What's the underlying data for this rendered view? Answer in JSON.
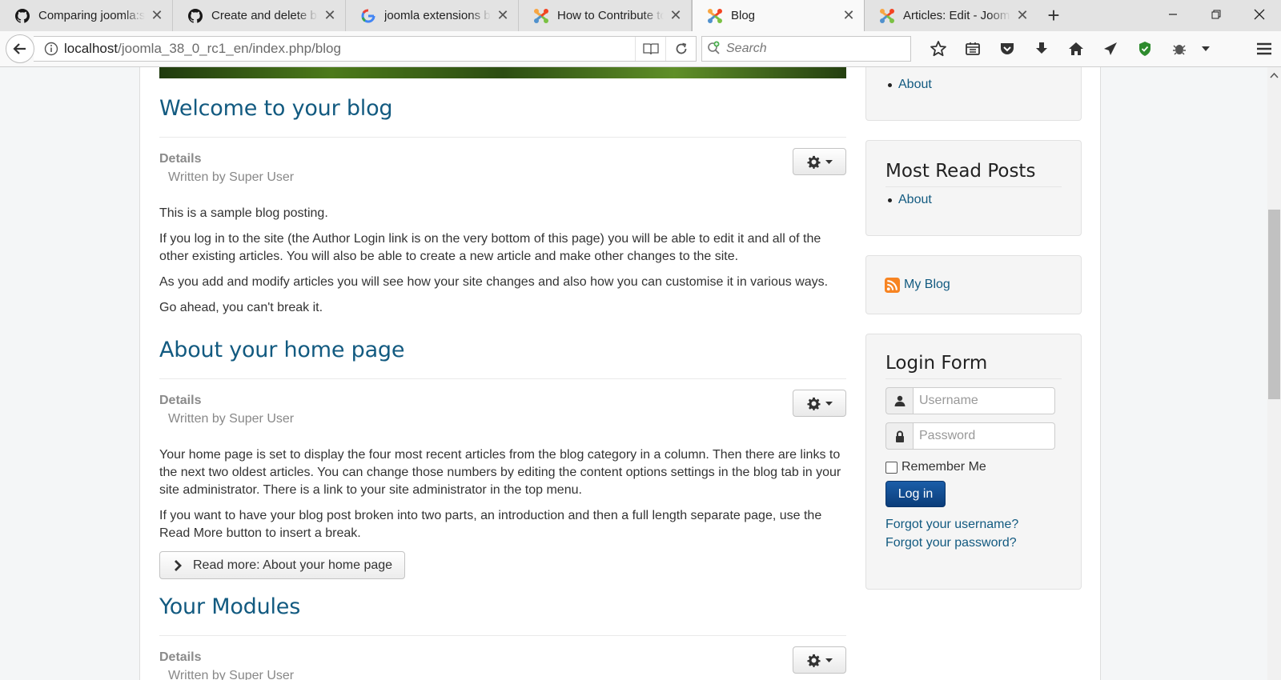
{
  "browser": {
    "tabs": [
      {
        "label": "Comparing joomla:staging",
        "icon": "github-icon"
      },
      {
        "label": "Create and delete branches",
        "icon": "github-icon"
      },
      {
        "label": "joomla extensions blog",
        "icon": "google-icon"
      },
      {
        "label": "How to Contribute to Joomla",
        "icon": "joomla-icon"
      },
      {
        "label": "Blog",
        "icon": "joomla-icon",
        "active": true
      },
      {
        "label": "Articles: Edit - Joomla",
        "icon": "joomla-icon"
      }
    ],
    "url_host": "localhost",
    "url_path": "/joomla_38_0_rc1_en/index.php/blog",
    "search_placeholder": "Search"
  },
  "articles": [
    {
      "title": "Welcome to your blog",
      "details_label": "Details",
      "author": "Written by Super User",
      "paragraphs": [
        "This is a sample blog posting.",
        "If you log in to the site (the Author Login link is on the very bottom of this page) you will be able to edit it and all of the other existing articles. You will also be able to create a new article and make other changes to the site.",
        "As you add and modify articles you will see how your site changes and also how you can customise it in various ways.",
        "Go ahead, you can't break it."
      ]
    },
    {
      "title": "About your home page",
      "details_label": "Details",
      "author": "Written by Super User",
      "paragraphs": [
        "Your home page is set to display the four most recent articles from the blog category in a column. Then there are links to the next two oldest articles. You can change those numbers by editing the content options settings in the blog tab in your site administrator. There is a link to your site administrator in the top menu.",
        "If you want to have your blog post broken into two parts, an introduction and then a full length separate page, use the Read More button to insert a break."
      ],
      "read_more": "Read more: About your home page"
    },
    {
      "title": "Your Modules",
      "details_label": "Details",
      "author": "Written by Super User"
    }
  ],
  "sidebar": {
    "top_list": [
      "About"
    ],
    "most_read": {
      "title": "Most Read Posts",
      "items": [
        "About"
      ]
    },
    "feed_link": "My Blog",
    "login": {
      "title": "Login Form",
      "username_placeholder": "Username",
      "password_placeholder": "Password",
      "remember_label": "Remember Me",
      "login_button": "Log in",
      "forgot_username": "Forgot your username?",
      "forgot_password": "Forgot your password?"
    }
  },
  "colors": {
    "link": "#125a80",
    "title": "#125a80",
    "login_button": "#0b3d7a"
  }
}
